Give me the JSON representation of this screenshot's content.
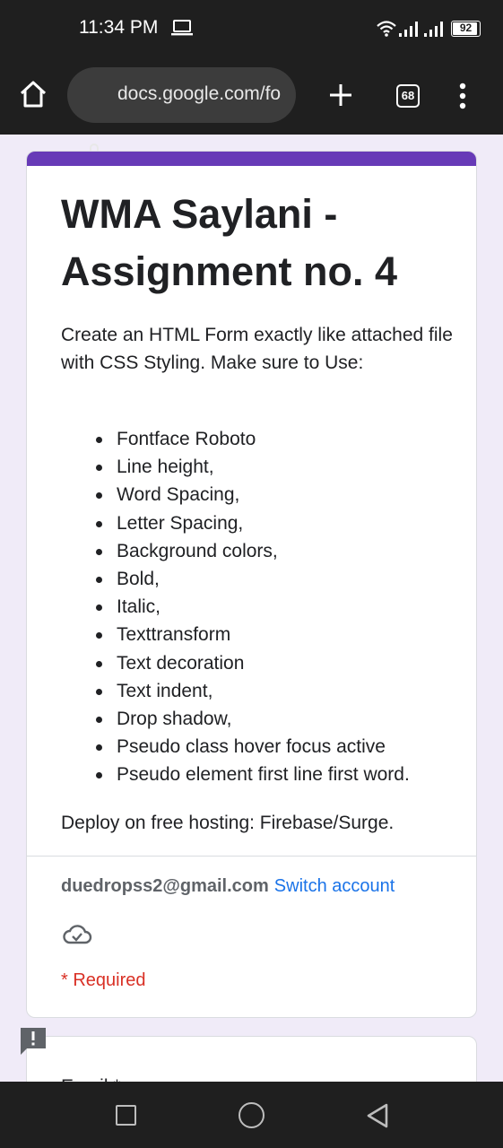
{
  "status_bar": {
    "time": "11:34 PM",
    "battery": "92",
    "battery_level_percent": 92,
    "icons": [
      "laptop-icon",
      "wifi-icon",
      "signal-icon",
      "signal-icon",
      "battery-icon"
    ]
  },
  "browser": {
    "url": "docs.google.com/fo",
    "tab_count": "68",
    "icons": [
      "home-icon",
      "lock-icon",
      "plus-icon",
      "tabs-icon",
      "more-vert-icon"
    ]
  },
  "form": {
    "accent_color": "#673ab7",
    "title": "WMA Saylani - Assignment no. 4",
    "description": "Create an HTML Form exactly like attached file with CSS Styling. Make sure to Use:",
    "items": [
      "Fontface Roboto",
      "Line height,",
      "Word Spacing,",
      "Letter Spacing,",
      "Background colors,",
      "Bold,",
      "Italic,",
      "Texttransform",
      "Text decoration",
      "Text indent,",
      "Drop shadow,",
      "Pseudo class hover focus active",
      "Pseudo element first line first word."
    ],
    "deploy": "Deploy on free hosting: Firebase/Surge.",
    "account_email": "duedropss2@gmail.com",
    "switch_account": "Switch account",
    "required_note": "* Required",
    "link_color": "#1a73e8",
    "required_color": "#d93025"
  },
  "next_question": {
    "label": "Email *"
  },
  "nav": {
    "icons": [
      "recents-square-icon",
      "home-circle-icon",
      "back-triangle-icon"
    ]
  }
}
